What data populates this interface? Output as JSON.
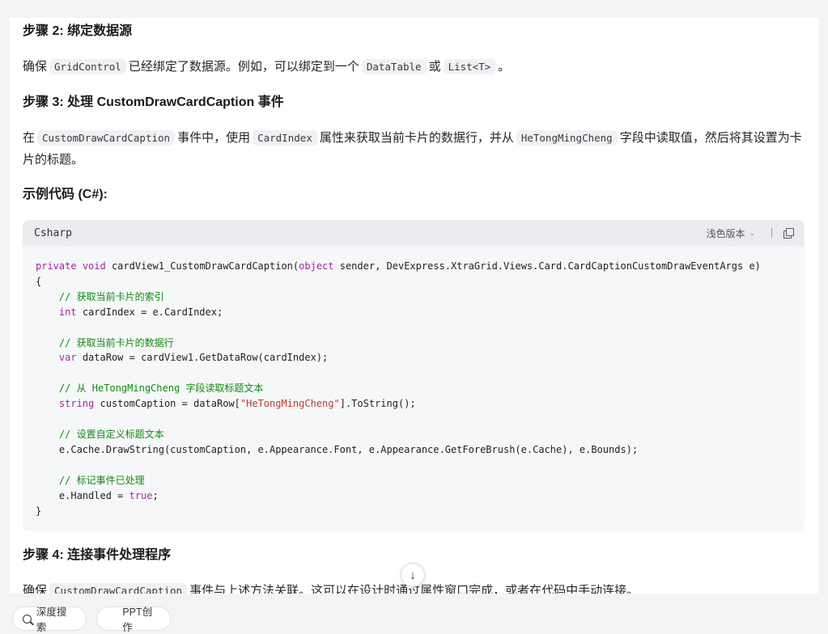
{
  "step2": {
    "heading": "步骤 2: 绑定数据源",
    "p_prefix": "确保",
    "code1": "GridControl",
    "p_mid": "已经绑定了数据源。例如，可以绑定到一个",
    "code2": "DataTable",
    "p_or": "或",
    "code3": "List<T>",
    "p_end": "。"
  },
  "step3": {
    "heading": "步骤 3: 处理 CustomDrawCardCaption 事件",
    "p_prefix": "在",
    "code1": "CustomDrawCardCaption",
    "p_mid1": "事件中，使用",
    "code2": "CardIndex",
    "p_mid2": "属性来获取当前卡片的数据行，并从",
    "code3": "HeTongMingCheng",
    "p_end": "字段中读取值，然后将其设置为卡片的标题。"
  },
  "example": {
    "heading": "示例代码 (C#):"
  },
  "code_block": {
    "language": "Csharp",
    "theme_label": "浅色版本",
    "lines": [
      [
        {
          "t": "private",
          "c": "kw"
        },
        {
          "t": " "
        },
        {
          "t": "void",
          "c": "kw"
        },
        {
          "t": " cardView1_CustomDrawCardCaption("
        },
        {
          "t": "object",
          "c": "kw"
        },
        {
          "t": " sender, DevExpress.XtraGrid.Views.Card.CardCaptionCustomDrawEventArgs e)"
        }
      ],
      [
        {
          "t": "{"
        }
      ],
      [
        {
          "t": "    "
        },
        {
          "t": "// 获取当前卡片的索引",
          "c": "cm"
        }
      ],
      [
        {
          "t": "    "
        },
        {
          "t": "int",
          "c": "kw"
        },
        {
          "t": " cardIndex = e.CardIndex;"
        }
      ],
      [
        {
          "t": ""
        }
      ],
      [
        {
          "t": "    "
        },
        {
          "t": "// 获取当前卡片的数据行",
          "c": "cm"
        }
      ],
      [
        {
          "t": "    "
        },
        {
          "t": "var",
          "c": "kw"
        },
        {
          "t": " dataRow = cardView1.GetDataRow(cardIndex);"
        }
      ],
      [
        {
          "t": ""
        }
      ],
      [
        {
          "t": "    "
        },
        {
          "t": "// 从 HeTongMingCheng 字段读取标题文本",
          "c": "cm"
        }
      ],
      [
        {
          "t": "    "
        },
        {
          "t": "string",
          "c": "kw"
        },
        {
          "t": " customCaption = dataRow["
        },
        {
          "t": "\"HeTongMingCheng\"",
          "c": "st"
        },
        {
          "t": "].ToString();"
        }
      ],
      [
        {
          "t": ""
        }
      ],
      [
        {
          "t": "    "
        },
        {
          "t": "// 设置自定义标题文本",
          "c": "cm"
        }
      ],
      [
        {
          "t": "    e.Cache.DrawString(customCaption, e.Appearance.Font, e.Appearance.GetForeBrush(e.Cache), e.Bounds);"
        }
      ],
      [
        {
          "t": ""
        }
      ],
      [
        {
          "t": "    "
        },
        {
          "t": "// 标记事件已处理",
          "c": "cm"
        }
      ],
      [
        {
          "t": "    e.Handled = "
        },
        {
          "t": "true",
          "c": "kw"
        },
        {
          "t": ";"
        }
      ],
      [
        {
          "t": "}"
        }
      ]
    ]
  },
  "step4": {
    "heading": "步骤 4: 连接事件处理程序",
    "p_prefix": "确保",
    "code1": "CustomDrawCardCaption",
    "p_end": "事件与上述方法关联。这可以在设计时通过属性窗口完成，或者在代码中手动连接。"
  },
  "scroll_down_icon": "↓",
  "bottom_bar": {
    "deep_search_label": "深度搜索",
    "ppt_label": "PPT创作"
  },
  "colors": {
    "keyword": "#a626a4",
    "comment": "#138a13",
    "string": "#c0392b"
  }
}
